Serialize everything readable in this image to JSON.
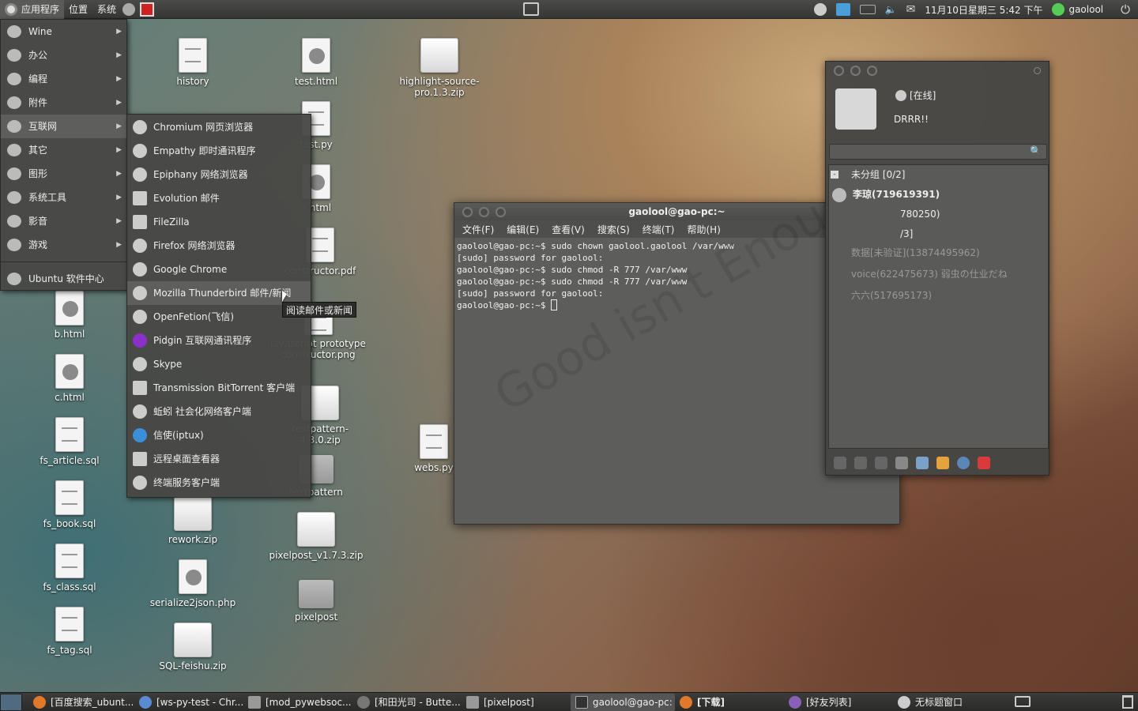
{
  "topbar": {
    "apps": "应用程序",
    "places": "位置",
    "system": "系统",
    "clock": "11月10日星期三 5:42 下午",
    "user": "gaolool"
  },
  "app_menu": {
    "items": [
      {
        "label": "Wine",
        "icon": "wine-icon",
        "has_sub": true
      },
      {
        "label": "办公",
        "icon": "office-icon",
        "has_sub": true
      },
      {
        "label": "编程",
        "icon": "programming-icon",
        "has_sub": true
      },
      {
        "label": "附件",
        "icon": "accessories-icon",
        "has_sub": true
      },
      {
        "label": "互联网",
        "icon": "internet-icon",
        "has_sub": true,
        "selected": true
      },
      {
        "label": "其它",
        "icon": "other-icon",
        "has_sub": true
      },
      {
        "label": "图形",
        "icon": "graphics-icon",
        "has_sub": true
      },
      {
        "label": "系统工具",
        "icon": "system-tools-icon",
        "has_sub": true
      },
      {
        "label": "影音",
        "icon": "sound-video-icon",
        "has_sub": true
      },
      {
        "label": "游戏",
        "icon": "games-icon",
        "has_sub": true
      }
    ],
    "software_center": "Ubuntu 软件中心"
  },
  "internet_submenu": [
    "Chromium 网页浏览器",
    "Empathy 即时通讯程序",
    "Epiphany 网络浏览器",
    "Evolution 邮件",
    "FileZilla",
    "Firefox 网络浏览器",
    "Google Chrome",
    "Mozilla Thunderbird 邮件/新闻",
    "OpenFetion(飞信)",
    "Pidgin 互联网通讯程序",
    "Skype",
    "Transmission BitTorrent 客户端",
    "蚯蚓 社会化网络客户端",
    "信使(iptux)",
    "远程桌面查看器",
    "终端服务客户端"
  ],
  "tooltip": "阅读邮件或新闻",
  "desktop": {
    "history": "history",
    "test_html": "test.html",
    "highlight": "highlight-source-pro.1.3.zip",
    "test_py": "test.py",
    "x_html": "x.html",
    "constructor_pdf": "constructor.pdf",
    "prototype_png": "javascript prototype constructor.png",
    "png_label": "PNG",
    "textpattern_zip": "textpattern-4.3.0.zip",
    "textpattern": "textpattern",
    "webs_py": "webs.py",
    "b_html": "b.html",
    "c_html": "c.html",
    "fs_article": "fs_article.sql",
    "fs_book": "fs_book.sql",
    "fs_class": "fs_class.sql",
    "fs_tag": "fs_tag.sql",
    "rework_zip": "rework.zip",
    "serialize": "serialize2json.php",
    "sql_feishu": "SQL-feishu.zip",
    "pixelpost_zip": "pixelpost_v1.7.3.zip",
    "pixelpost": "pixelpost"
  },
  "terminal": {
    "title": "gaolool@gao-pc:~",
    "menu": [
      "文件(F)",
      "编辑(E)",
      "查看(V)",
      "搜索(S)",
      "终端(T)",
      "帮助(H)"
    ],
    "lines": [
      "gaolool@gao-pc:~$ sudo chown gaolool.gaolool /var/www",
      "[sudo] password for gaolool:",
      "gaolool@gao-pc:~$ sudo chmod -R 777 /var/www",
      "gaolool@gao-pc:~$ sudo chmod -R 777 /var/www",
      "[sudo] password for gaolool:",
      "gaolool@gao-pc:~$ "
    ],
    "watermark": "Good isn't Enough"
  },
  "im": {
    "status": "[在线]",
    "nickname": "DRRR!!",
    "contacts": [
      "未分组 [0/2]",
      "李琼(719619391)",
      "780250)",
      "/3]",
      "数据[未验证](13874495962)",
      "voice(622475673) 弱虫の仕业だね",
      "六六(517695173)"
    ]
  },
  "taskbar": [
    "[百度搜索_ubunt...",
    "[ws-py-test - Chr...",
    "[mod_pywebsoc...",
    "[和田光司 - Butte...",
    "[pixelpost]",
    "gaolool@gao-pc: ~",
    "[下载]",
    "[好友列表]",
    "无标题窗口"
  ]
}
